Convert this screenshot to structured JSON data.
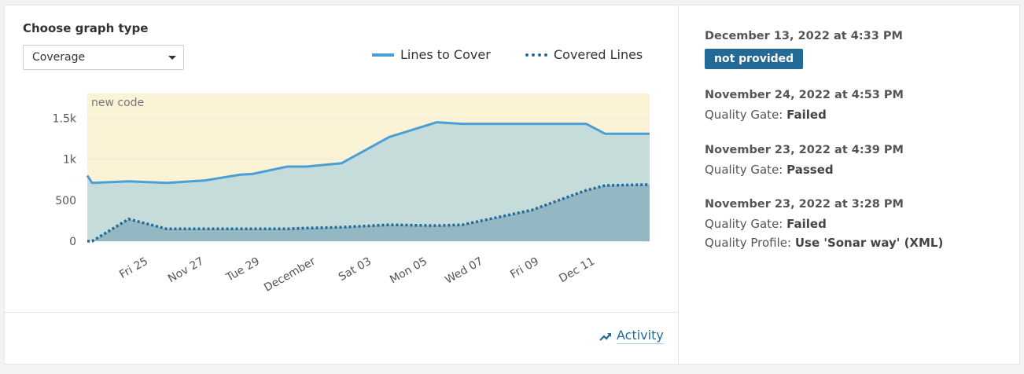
{
  "graph": {
    "title": "Choose graph type",
    "select_value": "Coverage",
    "legend": [
      {
        "label": "Lines to Cover",
        "style": "solid",
        "color": "#4b9fd5"
      },
      {
        "label": "Covered Lines",
        "style": "dotted",
        "color": "#236a97"
      }
    ],
    "activity_label": "Activity"
  },
  "chart_data": {
    "type": "area",
    "annotation": "new code",
    "y_ticks": [
      "0",
      "500",
      "1k",
      "1.5k"
    ],
    "x_tick_labels": [
      "Fri 25",
      "Nov 27",
      "Tue 29",
      "December",
      "Sat 03",
      "Mon 05",
      "Wed 07",
      "Fri 09",
      "Dec 11"
    ],
    "ylim": [
      0,
      1800
    ],
    "grid": true,
    "legend_position": "top-right",
    "colors": {
      "new_code_bg": "#fbf3d5",
      "lines_to_cover_area": "#c5dcdb",
      "covered_area": "#94b7c4",
      "lines_to_cover": "#4b9fd5",
      "covered": "#236a97"
    },
    "x": [
      0,
      0.15,
      1.3,
      2.5,
      3.7,
      4.8,
      5.2,
      6.3,
      6.9,
      8.0,
      9.5,
      11.0,
      11.8,
      14.0,
      15.7,
      16.3,
      17.7
    ],
    "series": [
      {
        "name": "Lines to Cover",
        "values": [
          800,
          710,
          730,
          710,
          740,
          810,
          820,
          910,
          910,
          950,
          1270,
          1450,
          1430,
          1430,
          1430,
          1310,
          1310
        ]
      },
      {
        "name": "Covered Lines",
        "values": [
          0,
          0,
          270,
          150,
          150,
          150,
          150,
          150,
          160,
          170,
          200,
          190,
          200,
          380,
          620,
          680,
          690
        ]
      }
    ]
  },
  "history": [
    {
      "date": "December 13, 2022 at 4:33 PM",
      "badge": "not provided"
    },
    {
      "date": "November 24, 2022 at 4:53 PM",
      "qg_label": "Quality Gate:",
      "qg_value": "Failed"
    },
    {
      "date": "November 23, 2022 at 4:39 PM",
      "qg_label": "Quality Gate:",
      "qg_value": "Passed"
    },
    {
      "date": "November 23, 2022 at 3:28 PM",
      "qg_label": "Quality Gate:",
      "qg_value": "Failed",
      "qp_label": "Quality Profile:",
      "qp_value": "Use 'Sonar way' (XML)"
    }
  ]
}
